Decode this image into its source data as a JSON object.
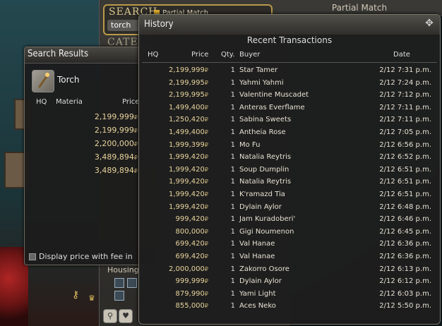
{
  "search": {
    "title": "SEARCH",
    "query": "torch",
    "partial_match_label": "Partial Match",
    "category_label": "CATEG",
    "top_tab_label": "Partial Match",
    "housing_label": "Housing"
  },
  "results": {
    "title": "Search Results",
    "item_name": "Torch",
    "columns": {
      "hq": "HQ",
      "materia": "Materia",
      "price": "Price"
    },
    "prices": [
      "2,199,999",
      "2,199,999",
      "2,200,000",
      "3,489,894",
      "3,489,894"
    ],
    "footer_label": "Display price with fee in"
  },
  "history": {
    "title": "History",
    "subtitle": "Recent Transactions",
    "columns": {
      "hq": "HQ",
      "price": "Price",
      "qty": "Qty.",
      "buyer": "Buyer",
      "date": "Date"
    },
    "currency_symbol": "₽",
    "rows": [
      {
        "price": "2,199,999",
        "qty": "1",
        "buyer": "Star Tamer",
        "date": "2/12 7:31 p.m."
      },
      {
        "price": "2,199,995",
        "qty": "1",
        "buyer": "Yahmi Yahmi",
        "date": "2/12 7:24 p.m."
      },
      {
        "price": "2,199,995",
        "qty": "1",
        "buyer": "Valentine Muscadet",
        "date": "2/12 7:12 p.m."
      },
      {
        "price": "1,499,400",
        "qty": "1",
        "buyer": "Anteras Everflame",
        "date": "2/12 7:11 p.m."
      },
      {
        "price": "1,250,420",
        "qty": "1",
        "buyer": "Sabina Sweets",
        "date": "2/12 7:11 p.m."
      },
      {
        "price": "1,499,400",
        "qty": "1",
        "buyer": "Antheia Rose",
        "date": "2/12 7:05 p.m."
      },
      {
        "price": "1,999,399",
        "qty": "1",
        "buyer": "Mo Fu",
        "date": "2/12 6:56 p.m."
      },
      {
        "price": "1,999,420",
        "qty": "1",
        "buyer": "Natalia Reytris",
        "date": "2/12 6:52 p.m."
      },
      {
        "price": "1,999,420",
        "qty": "1",
        "buyer": "Soup Dumplin",
        "date": "2/12 6:51 p.m."
      },
      {
        "price": "1,999,420",
        "qty": "1",
        "buyer": "Natalia Reytris",
        "date": "2/12 6:51 p.m."
      },
      {
        "price": "1,999,420",
        "qty": "1",
        "buyer": "K'ramazd Tia",
        "date": "2/12 6:51 p.m."
      },
      {
        "price": "1,999,420",
        "qty": "1",
        "buyer": "Dylain Aylor",
        "date": "2/12 6:48 p.m."
      },
      {
        "price": "999,420",
        "qty": "1",
        "buyer": "Jam Kuradoberi'",
        "date": "2/12 6:46 p.m."
      },
      {
        "price": "800,000",
        "qty": "1",
        "buyer": "Gigi Noumenon",
        "date": "2/12 6:45 p.m."
      },
      {
        "price": "699,420",
        "qty": "1",
        "buyer": "Val Hanae",
        "date": "2/12 6:36 p.m."
      },
      {
        "price": "699,420",
        "qty": "1",
        "buyer": "Val Hanae",
        "date": "2/12 6:36 p.m."
      },
      {
        "price": "2,000,000",
        "qty": "1",
        "buyer": "Zakorro Osore",
        "date": "2/12 6:13 p.m."
      },
      {
        "price": "999,999",
        "qty": "1",
        "buyer": "Dylain Aylor",
        "date": "2/12 6:12 p.m."
      },
      {
        "price": "879,990",
        "qty": "1",
        "buyer": "Yami Light",
        "date": "2/12 6:03 p.m."
      },
      {
        "price": "855,000",
        "qty": "1",
        "buyer": "Aces Neko",
        "date": "2/12 5:50 p.m."
      }
    ]
  }
}
